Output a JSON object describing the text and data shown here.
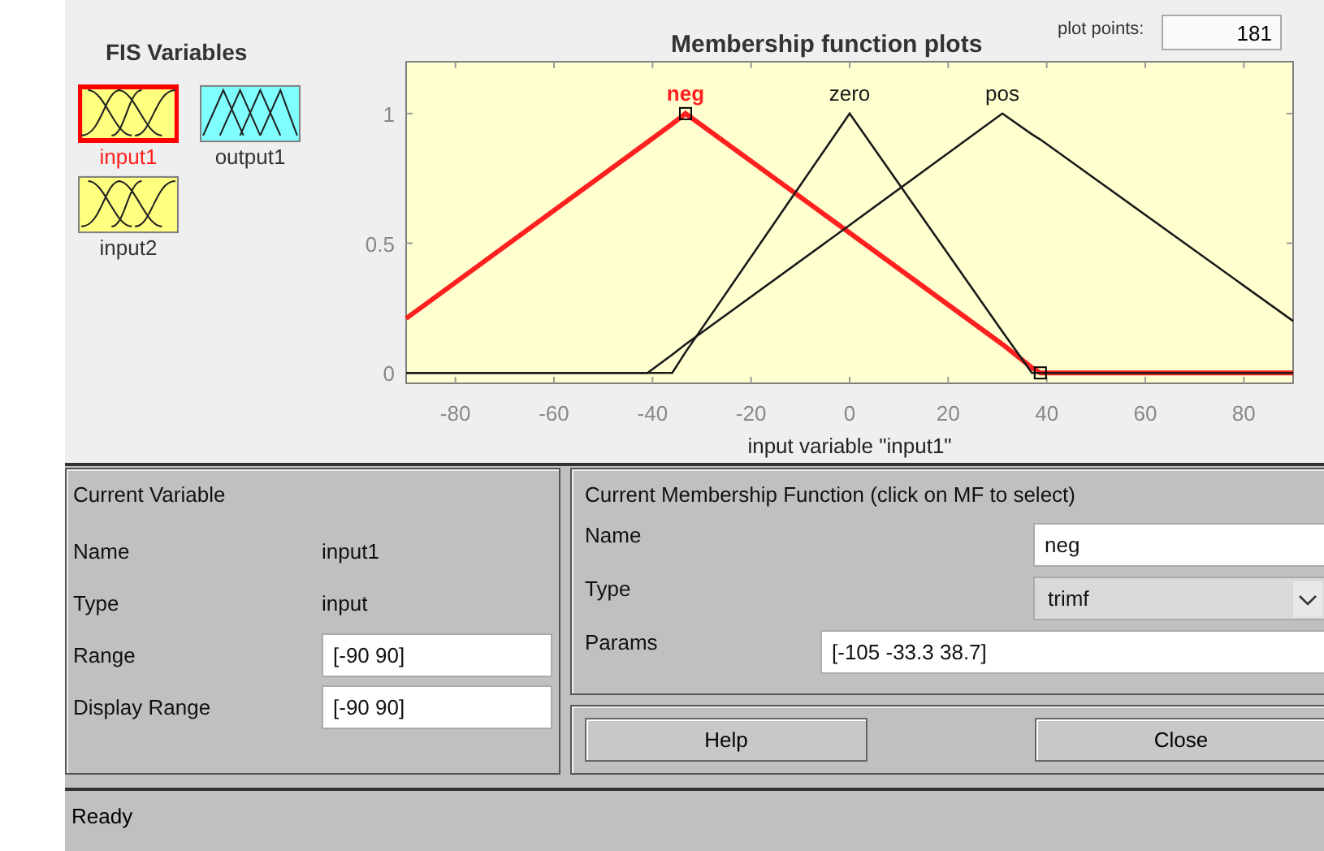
{
  "fis_variables": {
    "title": "FIS Variables",
    "items": [
      {
        "label": "input1",
        "kind": "input",
        "selected": true
      },
      {
        "label": "output1",
        "kind": "output",
        "selected": false
      },
      {
        "label": "input2",
        "kind": "input",
        "selected": false
      }
    ]
  },
  "plot": {
    "plot_points_label": "plot points:",
    "plot_points": "181",
    "chart_data": {
      "type": "line",
      "title": "Membership function plots",
      "xlabel": "input variable \"input1\"",
      "x": [
        -90,
        -41,
        -36,
        -33.3,
        0,
        31,
        37,
        38.7,
        90
      ],
      "series": [
        {
          "name": "neg",
          "color": "#ff2020",
          "values": [
            0.21,
            0.89,
            0.96,
            1,
            0.54,
            0.11,
            0.02,
            0,
            0
          ]
        },
        {
          "name": "zero",
          "color": "#1a1a1a",
          "values": [
            0,
            0,
            0,
            0.08,
            1,
            0.16,
            0,
            0,
            0
          ]
        },
        {
          "name": "pos",
          "color": "#1a1a1a",
          "values": [
            0,
            0,
            0.07,
            0.11,
            0.57,
            1,
            0.92,
            0.9,
            0.2
          ]
        }
      ],
      "xlim": [
        -90,
        90
      ],
      "ylim": [
        -0.04,
        1.2
      ],
      "xticks": [
        -80,
        -60,
        -40,
        -20,
        0,
        20,
        40,
        60,
        80
      ],
      "yticks": [
        0,
        0.5,
        1
      ]
    },
    "mf_states": [
      {
        "selected": true
      },
      {
        "selected": false
      },
      {
        "selected": false
      }
    ]
  },
  "current_variable": {
    "title": "Current Variable",
    "rows": [
      {
        "label": "Name",
        "kind": "text",
        "value": "input1"
      },
      {
        "label": "Type",
        "kind": "text",
        "value": "input"
      },
      {
        "label": "Range",
        "kind": "field",
        "value": "[-90 90]"
      },
      {
        "label": "Display Range",
        "kind": "field",
        "value": "[-90 90]"
      }
    ]
  },
  "current_mf": {
    "title": "Current Membership Function (click on MF to select)",
    "rows": [
      {
        "label": "Name",
        "kind": "field",
        "value": "neg"
      },
      {
        "label": "Type",
        "kind": "select",
        "value": "trimf"
      },
      {
        "label": "Params",
        "kind": "wide_field",
        "value": "[-105 -33.3 38.7]"
      }
    ]
  },
  "buttons": [
    "Help",
    "Close"
  ],
  "status_bar": "Ready"
}
